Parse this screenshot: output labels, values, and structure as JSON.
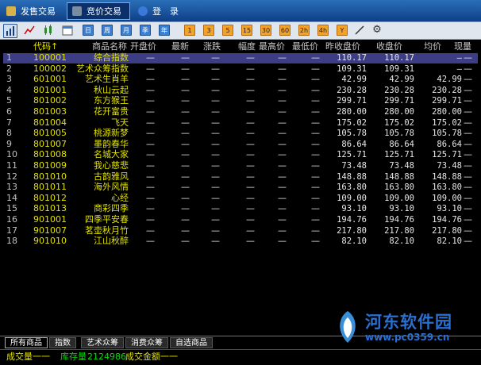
{
  "top_tabs": [
    {
      "label": "发售交易",
      "icon": "wheat-icon",
      "active": false
    },
    {
      "label": "竞价交易",
      "icon": "hammer-icon",
      "active": true
    },
    {
      "label": "登　录",
      "icon": "user-icon",
      "active": false
    }
  ],
  "toolbar": {
    "period_buttons": [
      "日",
      "周",
      "月",
      "季",
      "年"
    ],
    "minute_buttons": [
      "1",
      "3",
      "5",
      "15",
      "30",
      "60",
      "2h",
      "4h",
      "Y"
    ]
  },
  "table": {
    "columns": [
      "代码↑",
      "商品名称",
      "开盘价",
      "最新",
      "涨跌",
      "幅度",
      "最高价",
      "最低价",
      "昨收盘价",
      "收盘价",
      "均价",
      "现量"
    ],
    "rows": [
      {
        "idx": "1",
        "code": "100001",
        "name": "综合指数",
        "open": "—",
        "last": "—",
        "chg": "—",
        "pct": "—",
        "high": "—",
        "low": "—",
        "prev": "110.17",
        "close": "110.17",
        "avg": "—",
        "vol": "—"
      },
      {
        "idx": "2",
        "code": "100002",
        "name": "艺术众筹指数",
        "open": "—",
        "last": "—",
        "chg": "—",
        "pct": "—",
        "high": "—",
        "low": "—",
        "prev": "109.31",
        "close": "109.31",
        "avg": "—",
        "vol": "—"
      },
      {
        "idx": "3",
        "code": "601001",
        "name": "艺术生肖羊",
        "open": "—",
        "last": "—",
        "chg": "—",
        "pct": "—",
        "high": "—",
        "low": "—",
        "prev": "42.99",
        "close": "42.99",
        "avg": "42.99",
        "vol": "—"
      },
      {
        "idx": "4",
        "code": "801001",
        "name": "秋山云起",
        "open": "—",
        "last": "—",
        "chg": "—",
        "pct": "—",
        "high": "—",
        "low": "—",
        "prev": "230.28",
        "close": "230.28",
        "avg": "230.28",
        "vol": "—"
      },
      {
        "idx": "5",
        "code": "801002",
        "name": "东方猴王",
        "open": "—",
        "last": "—",
        "chg": "—",
        "pct": "—",
        "high": "—",
        "low": "—",
        "prev": "299.71",
        "close": "299.71",
        "avg": "299.71",
        "vol": "—"
      },
      {
        "idx": "6",
        "code": "801003",
        "name": "花开富贵",
        "open": "—",
        "last": "—",
        "chg": "—",
        "pct": "—",
        "high": "—",
        "low": "—",
        "prev": "280.00",
        "close": "280.00",
        "avg": "280.00",
        "vol": "—"
      },
      {
        "idx": "7",
        "code": "801004",
        "name": "飞天",
        "open": "—",
        "last": "—",
        "chg": "—",
        "pct": "—",
        "high": "—",
        "low": "—",
        "prev": "175.02",
        "close": "175.02",
        "avg": "175.02",
        "vol": "—"
      },
      {
        "idx": "8",
        "code": "801005",
        "name": "桃源新梦",
        "open": "—",
        "last": "—",
        "chg": "—",
        "pct": "—",
        "high": "—",
        "low": "—",
        "prev": "105.78",
        "close": "105.78",
        "avg": "105.78",
        "vol": "—"
      },
      {
        "idx": "9",
        "code": "801007",
        "name": "墨韵春华",
        "open": "—",
        "last": "—",
        "chg": "—",
        "pct": "—",
        "high": "—",
        "low": "—",
        "prev": "86.64",
        "close": "86.64",
        "avg": "86.64",
        "vol": "—"
      },
      {
        "idx": "10",
        "code": "801008",
        "name": "名城大家",
        "open": "—",
        "last": "—",
        "chg": "—",
        "pct": "—",
        "high": "—",
        "low": "—",
        "prev": "125.71",
        "close": "125.71",
        "avg": "125.71",
        "vol": "—"
      },
      {
        "idx": "11",
        "code": "801009",
        "name": "我心慈悲",
        "open": "—",
        "last": "—",
        "chg": "—",
        "pct": "—",
        "high": "—",
        "low": "—",
        "prev": "73.48",
        "close": "73.48",
        "avg": "73.48",
        "vol": "—"
      },
      {
        "idx": "12",
        "code": "801010",
        "name": "古韵雅风",
        "open": "—",
        "last": "—",
        "chg": "—",
        "pct": "—",
        "high": "—",
        "low": "—",
        "prev": "148.88",
        "close": "148.88",
        "avg": "148.88",
        "vol": "—"
      },
      {
        "idx": "13",
        "code": "801011",
        "name": "海外风情",
        "open": "—",
        "last": "—",
        "chg": "—",
        "pct": "—",
        "high": "—",
        "low": "—",
        "prev": "163.80",
        "close": "163.80",
        "avg": "163.80",
        "vol": "—"
      },
      {
        "idx": "14",
        "code": "801012",
        "name": "心经",
        "open": "—",
        "last": "—",
        "chg": "—",
        "pct": "—",
        "high": "—",
        "low": "—",
        "prev": "109.00",
        "close": "109.00",
        "avg": "109.00",
        "vol": "—"
      },
      {
        "idx": "15",
        "code": "801013",
        "name": "商彩四季",
        "open": "—",
        "last": "—",
        "chg": "—",
        "pct": "—",
        "high": "—",
        "low": "—",
        "prev": "93.10",
        "close": "93.10",
        "avg": "93.10",
        "vol": "—"
      },
      {
        "idx": "16",
        "code": "901001",
        "name": "四季平安春",
        "open": "—",
        "last": "—",
        "chg": "—",
        "pct": "—",
        "high": "—",
        "low": "—",
        "prev": "194.76",
        "close": "194.76",
        "avg": "194.76",
        "vol": "—"
      },
      {
        "idx": "17",
        "code": "901007",
        "name": "茗壶秋月竹",
        "open": "—",
        "last": "—",
        "chg": "—",
        "pct": "—",
        "high": "—",
        "low": "—",
        "prev": "217.80",
        "close": "217.80",
        "avg": "217.80",
        "vol": "—"
      },
      {
        "idx": "18",
        "code": "901010",
        "name": "江山秋醉",
        "open": "—",
        "last": "—",
        "chg": "—",
        "pct": "—",
        "high": "—",
        "low": "—",
        "prev": "82.10",
        "close": "82.10",
        "avg": "82.10",
        "vol": "—"
      }
    ]
  },
  "bottom_tabs": [
    "所有商品",
    "指数",
    "艺术众筹",
    "消费众筹",
    "自选商品"
  ],
  "status": {
    "volume": "成交量一一",
    "inventory_label": "库存量",
    "inventory_value": "2124986",
    "amount": "成交金额一一"
  },
  "watermark": {
    "title": "河东软件园",
    "url": "www.pc0359.cn"
  },
  "colors": {
    "selected_row": "#3d3d86",
    "code_text": "#e0e000",
    "inventory": "#00e000"
  }
}
